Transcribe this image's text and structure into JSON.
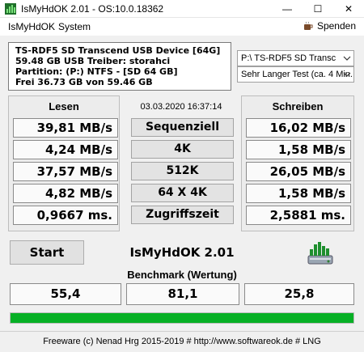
{
  "window": {
    "title": "IsMyHdOK 2.01 - OS:10.0.18362"
  },
  "menu": {
    "items": [
      "IsMyHdOK",
      "System"
    ],
    "spenden": "Spenden"
  },
  "drive_info": {
    "lines": [
      "TS-RDF5 SD  Transcend USB Device [64G]",
      "59.48 GB  USB Treiber: storahci",
      "Partition: (P:) NTFS - [SD 64 GB]",
      "Frei 36.73 GB von 59.46 GB"
    ]
  },
  "drive_select": {
    "value": "P:\\ TS-RDF5 SD  Transc"
  },
  "duration_select": {
    "value": "Sehr Langer Test (ca. 4 Min."
  },
  "columns": {
    "read": "Lesen",
    "write": "Schreiben"
  },
  "timestamp": "03.03.2020 16:37:14",
  "tests": [
    {
      "label": "Sequenziell",
      "read": "39,81 MB/s",
      "write": "16,02 MB/s"
    },
    {
      "label": "4K",
      "read": "4,24 MB/s",
      "write": "1,58 MB/s"
    },
    {
      "label": "512K",
      "read": "37,57 MB/s",
      "write": "26,05 MB/s"
    },
    {
      "label": "64 X 4K",
      "read": "4,82 MB/s",
      "write": "1,58 MB/s"
    },
    {
      "label": "Zugriffszeit",
      "read": "0,9667 ms.",
      "write": "2,5881 ms."
    }
  ],
  "start_button": "Start",
  "app_name": "IsMyHdOK 2.01",
  "benchmark": {
    "title": "Benchmark (Wertung)",
    "values": [
      "55,4",
      "81,1",
      "25,8"
    ]
  },
  "progress": {
    "fraction": 1.0,
    "color": "#06b025"
  },
  "footer": "Freeware (c) Nenad Hrg 2015-2019 # http://www.softwareok.de    # LNG",
  "icons": {
    "app": "disk-chart-icon",
    "coffee": "coffee-cup-icon",
    "drive": "hard-drive-icon"
  }
}
